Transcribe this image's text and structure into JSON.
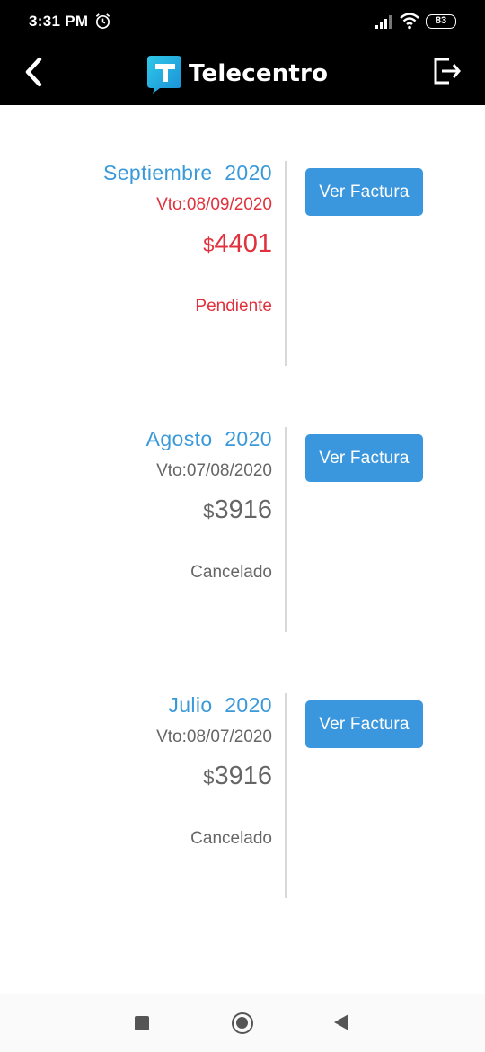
{
  "status_bar": {
    "time": "3:31 PM",
    "battery": "83",
    "icons": [
      "alarm-icon",
      "signal-icon",
      "wifi-icon",
      "battery-icon"
    ]
  },
  "app_bar": {
    "brand": "Telecentro",
    "icons": [
      "back-arrow-icon",
      "telecentro-logo-icon",
      "logout-icon"
    ]
  },
  "colors": {
    "accent": "#3a9ad9",
    "button": "#3b97dd",
    "pending": "#e0313c",
    "text_gray": "#666666"
  },
  "invoices": [
    {
      "month": "Septiembre",
      "year": "2020",
      "due": "Vto:08/09/2020",
      "currency": "$",
      "amount": "4401",
      "status": "Pendiente",
      "button": "Ver Factura"
    },
    {
      "month": "Agosto",
      "year": "2020",
      "due": "Vto:07/08/2020",
      "currency": "$",
      "amount": "3916",
      "status": "Cancelado",
      "button": "Ver Factura"
    },
    {
      "month": "Julio",
      "year": "2020",
      "due": "Vto:08/07/2020",
      "currency": "$",
      "amount": "3916",
      "status": "Cancelado",
      "button": "Ver Factura"
    }
  ],
  "nav_bar": {
    "icons": [
      "recent-apps-icon",
      "home-icon",
      "back-icon"
    ]
  }
}
